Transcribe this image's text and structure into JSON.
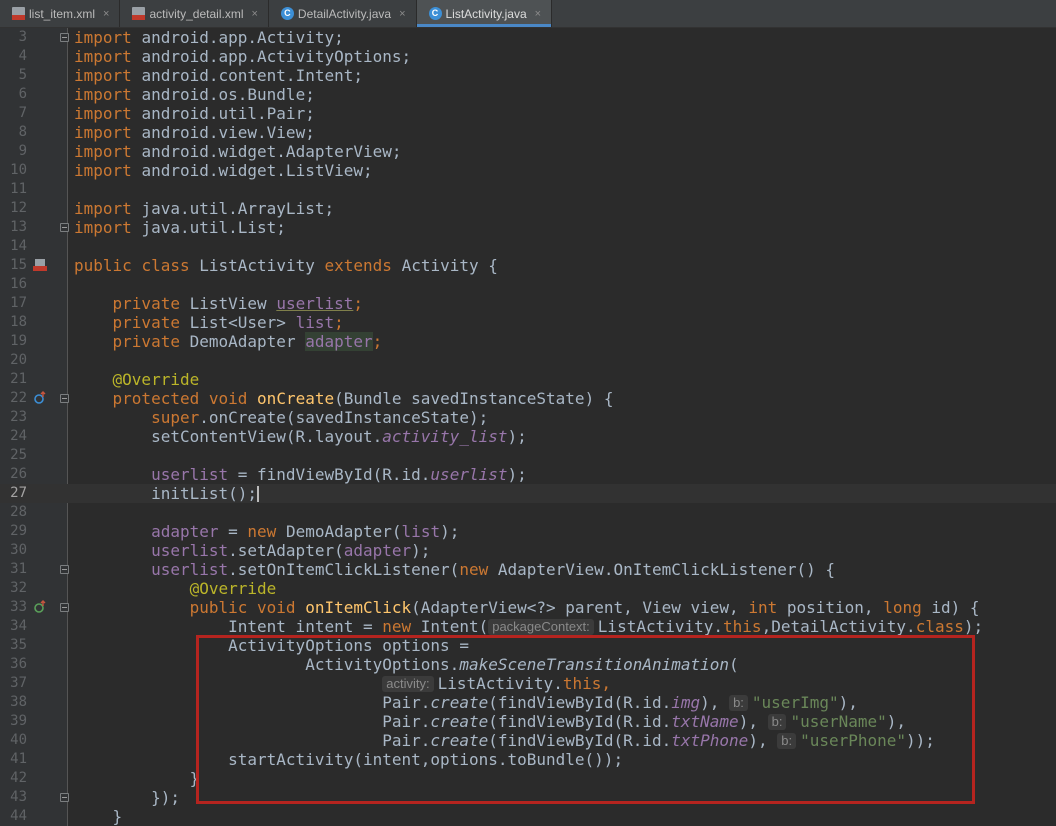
{
  "tabs": [
    {
      "label": "list_item.xml",
      "icon": "xml-file-icon",
      "active": false
    },
    {
      "label": "activity_detail.xml",
      "icon": "xml-file-icon",
      "active": false
    },
    {
      "label": "DetailActivity.java",
      "icon": "java-class-icon",
      "active": false
    },
    {
      "label": "ListActivity.java",
      "icon": "java-class-icon",
      "active": true
    }
  ],
  "tab_close_glyph": "×",
  "class_glyph": "C",
  "editor": {
    "current_line": 27,
    "line_numbers": {
      "l3": "3",
      "l4": "4",
      "l5": "5",
      "l6": "6",
      "l7": "7",
      "l8": "8",
      "l9": "9",
      "l10": "10",
      "l11": "11",
      "l12": "12",
      "l13": "13",
      "l14": "14",
      "l15": "15",
      "l16": "16",
      "l17": "17",
      "l18": "18",
      "l19": "19",
      "l20": "20",
      "l21": "21",
      "l22": "22",
      "l23": "23",
      "l24": "24",
      "l25": "25",
      "l26": "26",
      "l27": "27",
      "l28": "28",
      "l29": "29",
      "l30": "30",
      "l31": "31",
      "l32": "32",
      "l33": "33",
      "l34": "34",
      "l35": "35",
      "l36": "36",
      "l37": "37",
      "l38": "38",
      "l39": "39",
      "l40": "40",
      "l41": "41",
      "l42": "42",
      "l43": "43",
      "l44": "44"
    },
    "tokens": {
      "import": "import",
      "i3": "android.app.Activity;",
      "i4": "android.app.ActivityOptions;",
      "i5": "android.content.Intent;",
      "i6": "android.os.Bundle;",
      "i7": "android.util.Pair;",
      "i8": "android.view.View;",
      "i9": "android.widget.AdapterView;",
      "i10": "android.widget.ListView;",
      "i12": "java.util.ArrayList;",
      "i13": "java.util.List;",
      "public": "public",
      "class": "class",
      "extends": "extends",
      "private": "private",
      "protected": "protected",
      "void": "void",
      "new": "new",
      "this": "this",
      "int": "int",
      "long": "long",
      "super": "super",
      "class_kw": "class",
      "l15_name": "ListActivity",
      "l15_parent": "Activity {",
      "l17_type": "ListView",
      "l17_field": "userlist",
      "l18_type": "List<User>",
      "l18_field": "list",
      "l19_type": "DemoAdapter",
      "l19_field": "adapter",
      "semicolon": ";",
      "override": "@Override",
      "l22_method": "onCreate",
      "l22_params": "(Bundle savedInstanceState) {",
      "l23_rest": ".onCreate(savedInstanceState);",
      "l24_a": "setContentView(R.layout.",
      "l24_b": "activity_list",
      "l24_c": ");",
      "l26_field": "userlist",
      "l26_a": " = findViewById(R.id.",
      "l26_b": "userlist",
      "l26_c": ");",
      "l27": "initList();",
      "l29_field": "adapter",
      "l29_a": " = ",
      "l29_b": " DemoAdapter(",
      "l29_c": "list",
      "l29_d": ");",
      "l30_field": "userlist",
      "l30_a": ".setAdapter(",
      "l30_b": "adapter",
      "l30_c": ");",
      "l31_field": "userlist",
      "l31_a": ".setOnItemClickListener(",
      "l31_b": " AdapterView.OnItemClickListener() {",
      "l33_method": "onItemClick",
      "l33_a": "(AdapterView<?> parent, View view, ",
      "l33_b": " position, ",
      "l33_c": " id) {",
      "l34_a": "Intent intent = ",
      "l34_b": " Intent(",
      "l34_hint": "packageContext:",
      "l34_c": "ListActivity.",
      "l34_d": ",DetailActivity.",
      "l34_e": ");",
      "l35": "ActivityOptions options =",
      "l36_a": "ActivityOptions.",
      "l36_b": "makeSceneTransitionAnimation",
      "l36_c": "(",
      "l37_hint": "activity:",
      "l37_a": "ListActivity.",
      "l37_b": ",",
      "pair": "Pair.",
      "create": "create",
      "fvb": "(findViewById(R.id.",
      "l38_id": "img",
      "l39_id": "txtName",
      "l40_id": "txtPhone",
      "close_comma": "),",
      "hint_b": "b:",
      "l38_str": "\"userImg\"",
      "l39_str": "\"userName\"",
      "l40_str": "\"userPhone\"",
      "l38_end": "),",
      "l39_end": "),",
      "l40_end": "));",
      "l41": "startActivity(intent,options.toBundle());",
      "l42": "}",
      "l43": "});",
      "l44": "}"
    }
  },
  "colors": {
    "keyword": "#cc7832",
    "field": "#9876aa",
    "string": "#6a8759",
    "annotation": "#bbb529",
    "method_decl": "#ffc66d",
    "highlight_box": "#b5241f"
  }
}
